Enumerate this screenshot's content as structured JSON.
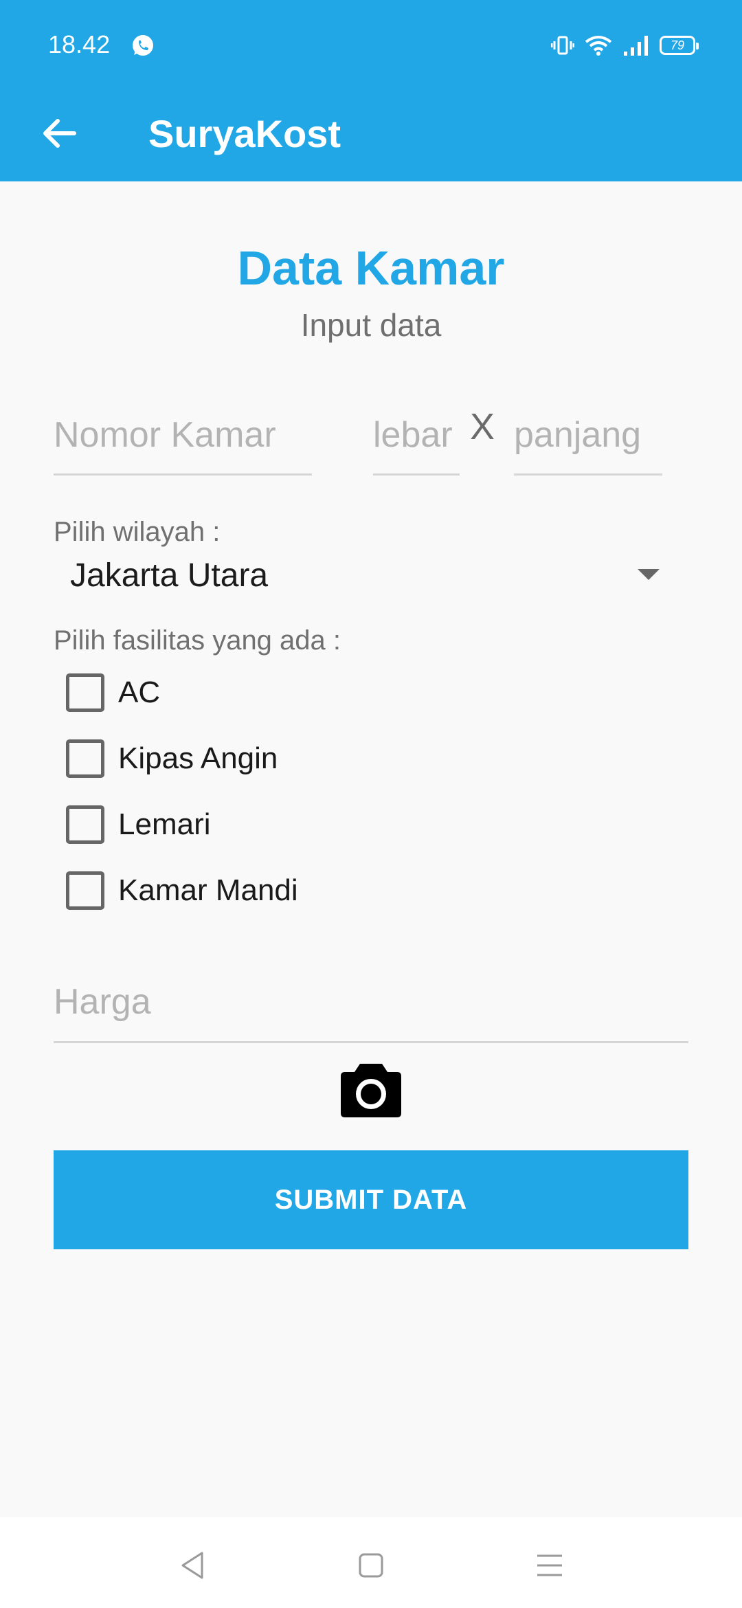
{
  "status_bar": {
    "time": "18.42",
    "battery": "79"
  },
  "app_bar": {
    "title": "SuryaKost"
  },
  "header": {
    "title": "Data Kamar",
    "subtitle": "Input data"
  },
  "form": {
    "room_number_placeholder": "Nomor Kamar",
    "width_placeholder": "lebar",
    "separator": "X",
    "length_placeholder": "panjang",
    "region_label": "Pilih wilayah :",
    "region_selected": "Jakarta Utara",
    "facilities_label": "Pilih fasilitas yang ada :",
    "facilities": [
      {
        "label": "AC",
        "checked": false
      },
      {
        "label": "Kipas Angin",
        "checked": false
      },
      {
        "label": "Lemari",
        "checked": false
      },
      {
        "label": "Kamar Mandi",
        "checked": false
      }
    ],
    "price_placeholder": "Harga",
    "submit_label": "SUBMIT DATA"
  },
  "colors": {
    "primary": "#21a7e6",
    "text_muted": "#707070"
  },
  "icons": {
    "back": "arrow-left-icon",
    "camera": "camera-icon",
    "whatsapp": "whatsapp-icon",
    "vibrate": "vibrate-icon",
    "wifi": "wifi-icon",
    "signal": "signal-icon",
    "battery": "battery-icon",
    "nav_back": "triangle-back-icon",
    "nav_home": "square-home-icon",
    "nav_menu": "menu-lines-icon"
  }
}
